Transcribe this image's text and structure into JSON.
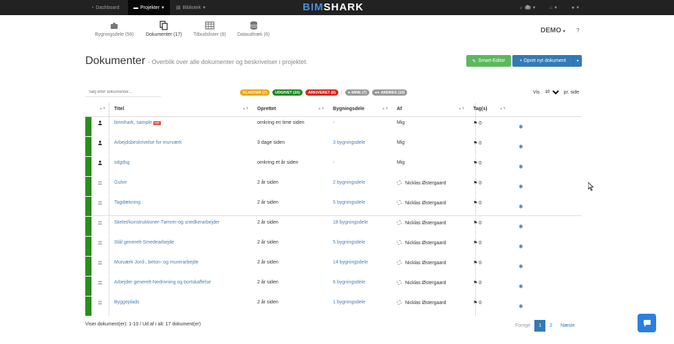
{
  "topbar": {
    "dashboard": "Dashboard",
    "projekter": "Projekter",
    "bibliotek": "Bibliotek",
    "logo_a": "BIM",
    "logo_b": "SHARK",
    "notif_count": "0"
  },
  "subnav": [
    {
      "label": "Bygningsdele (56)"
    },
    {
      "label": "Dokumenter (17)"
    },
    {
      "label": "Tilbudslister (8)"
    },
    {
      "label": "Dataudtræk (6)"
    }
  ],
  "project": {
    "name": "DEMO",
    "help": "?"
  },
  "page": {
    "title": "Dokumenter",
    "subtitle": "- Overblik over alle dokumenter og beskrivelser i projektet."
  },
  "buttons": {
    "smart_editor": "Smart-Editor",
    "new_doc": "Opret nyt dokument"
  },
  "search": {
    "placeholder": "Søg efter dokumenter..."
  },
  "filters": [
    {
      "label": "KLADDER (7)",
      "color": "#f0a30a"
    },
    {
      "label": "UDGIVET (10)",
      "color": "#1e8a1e"
    },
    {
      "label": "ARKIVERET (0)",
      "color": "#d9261c"
    },
    {
      "label": "MINE (7)",
      "color": "#999999"
    },
    {
      "label": "ANDRES (10)",
      "color": "#999999"
    }
  ],
  "perpage": {
    "label_pre": "Vis",
    "value": "10",
    "label_post": "pr. side"
  },
  "table": {
    "headers": [
      "Titel",
      "Oprettet",
      "Bygningsdele",
      "Af",
      "Tag(s)"
    ],
    "rows": [
      {
        "title": "bimshark, sample",
        "new": "nyt",
        "owner": "user",
        "created": "omkring en time siden",
        "parts": "-",
        "by": "Mig",
        "by_spinner": false,
        "tags": "0"
      },
      {
        "title": "Arbejdsbeskrivelse for murværk",
        "new": "",
        "owner": "user",
        "created": "3 dage siden",
        "parts": "3 bygningsdele",
        "by": "Mig",
        "by_spinner": false,
        "tags": "0"
      },
      {
        "title": "sdgdsg",
        "new": "",
        "owner": "user",
        "created": "omkring et år siden",
        "parts": "-",
        "by": "Mig",
        "by_spinner": false,
        "tags": "0"
      },
      {
        "title": "Gulve",
        "new": "",
        "owner": "group",
        "created": "2 år siden",
        "parts": "2 bygningsdele",
        "by": "Nicklas Østergaard",
        "by_spinner": true,
        "tags": "0"
      },
      {
        "title": "Tagdækning",
        "new": "",
        "owner": "group",
        "created": "2 år siden",
        "parts": "5 bygningsdele",
        "by": "Nicklas Østergaard",
        "by_spinner": true,
        "tags": "0"
      },
      {
        "title": "Skelet/konstruktioner-Tømrer-og snedkerarbejder",
        "new": "",
        "owner": "group",
        "created": "2 år siden",
        "parts": "18 bygningsdele",
        "by": "Nicklas Østergaard",
        "by_spinner": true,
        "tags": "0"
      },
      {
        "title": "Stål generelt-Smedearbejde",
        "new": "",
        "owner": "group",
        "created": "2 år siden",
        "parts": "5 bygningsdele",
        "by": "Nicklas Østergaard",
        "by_spinner": true,
        "tags": "0"
      },
      {
        "title": "Murværk Jord-, beton- og murerarbejde",
        "new": "",
        "owner": "group",
        "created": "2 år siden",
        "parts": "14 bygningsdele",
        "by": "Nicklas Østergaard",
        "by_spinner": true,
        "tags": "0"
      },
      {
        "title": "Arbejder generelt-Nedrivning og bortskaffelse",
        "new": "",
        "owner": "group",
        "created": "2 år siden",
        "parts": "6 bygningsdele",
        "by": "Nicklas Østergaard",
        "by_spinner": true,
        "tags": "0"
      },
      {
        "title": "Byggeplads",
        "new": "",
        "owner": "group",
        "created": "2 år siden",
        "parts": "1 bygningsdele",
        "by": "Nicklas Østergaard",
        "by_spinner": true,
        "tags": "0"
      }
    ]
  },
  "footer": {
    "summary": "Viser dokument(er): 1-10 / Ud af i alt: 17 dokument(er)"
  },
  "pager": {
    "prev": "Forrige",
    "pages": [
      "1",
      "2"
    ],
    "next": "Næste"
  },
  "colors": {
    "stripe": "#2a8c1e",
    "link": "#4a7fb5",
    "primary": "#337ab7",
    "success": "#5cb85c"
  }
}
